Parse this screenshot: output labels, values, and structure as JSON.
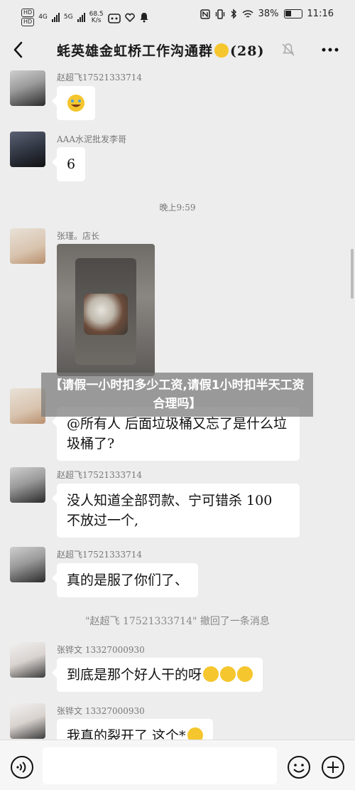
{
  "status_bar": {
    "hd1": "HD",
    "hd2": "HD",
    "net1": "4G",
    "net2": "5G",
    "speed": "68.5",
    "speed_unit": "K/s",
    "battery": "38%",
    "time": "11:16"
  },
  "header": {
    "title_before": "蚝英雄金虹桥工作沟通群",
    "title_count": "(28)"
  },
  "messages": [
    {
      "sender": "赵超飞17521333714",
      "text": ""
    },
    {
      "sender": "AAA水泥批发李哥",
      "text": "6"
    },
    {
      "sender": "张瑾。店长",
      "text": ""
    },
    {
      "sender": "",
      "text": "@所有人  后面垃圾桶又忘了是什么垃圾桶了?"
    },
    {
      "sender": "赵超飞17521333714",
      "text": "没人知道全部罚款、宁可错杀 100 不放过一个,"
    },
    {
      "sender": "赵超飞17521333714",
      "text": "真的是服了你们了、"
    },
    {
      "sender": "张铧文 13327000930",
      "text": "到底是那个好人干的呀"
    },
    {
      "sender": "张铧文 13327000930",
      "text": "我真的裂开了  这个*"
    }
  ],
  "timestamp": "晚上9:59",
  "recall_notice": "\"赵超飞 17521333714\" 撤回了一条消息",
  "caption": "【请假一小时扣多少工资,请假1小时扣半天工资合理吗】",
  "input_bar": {
    "placeholder": ""
  }
}
